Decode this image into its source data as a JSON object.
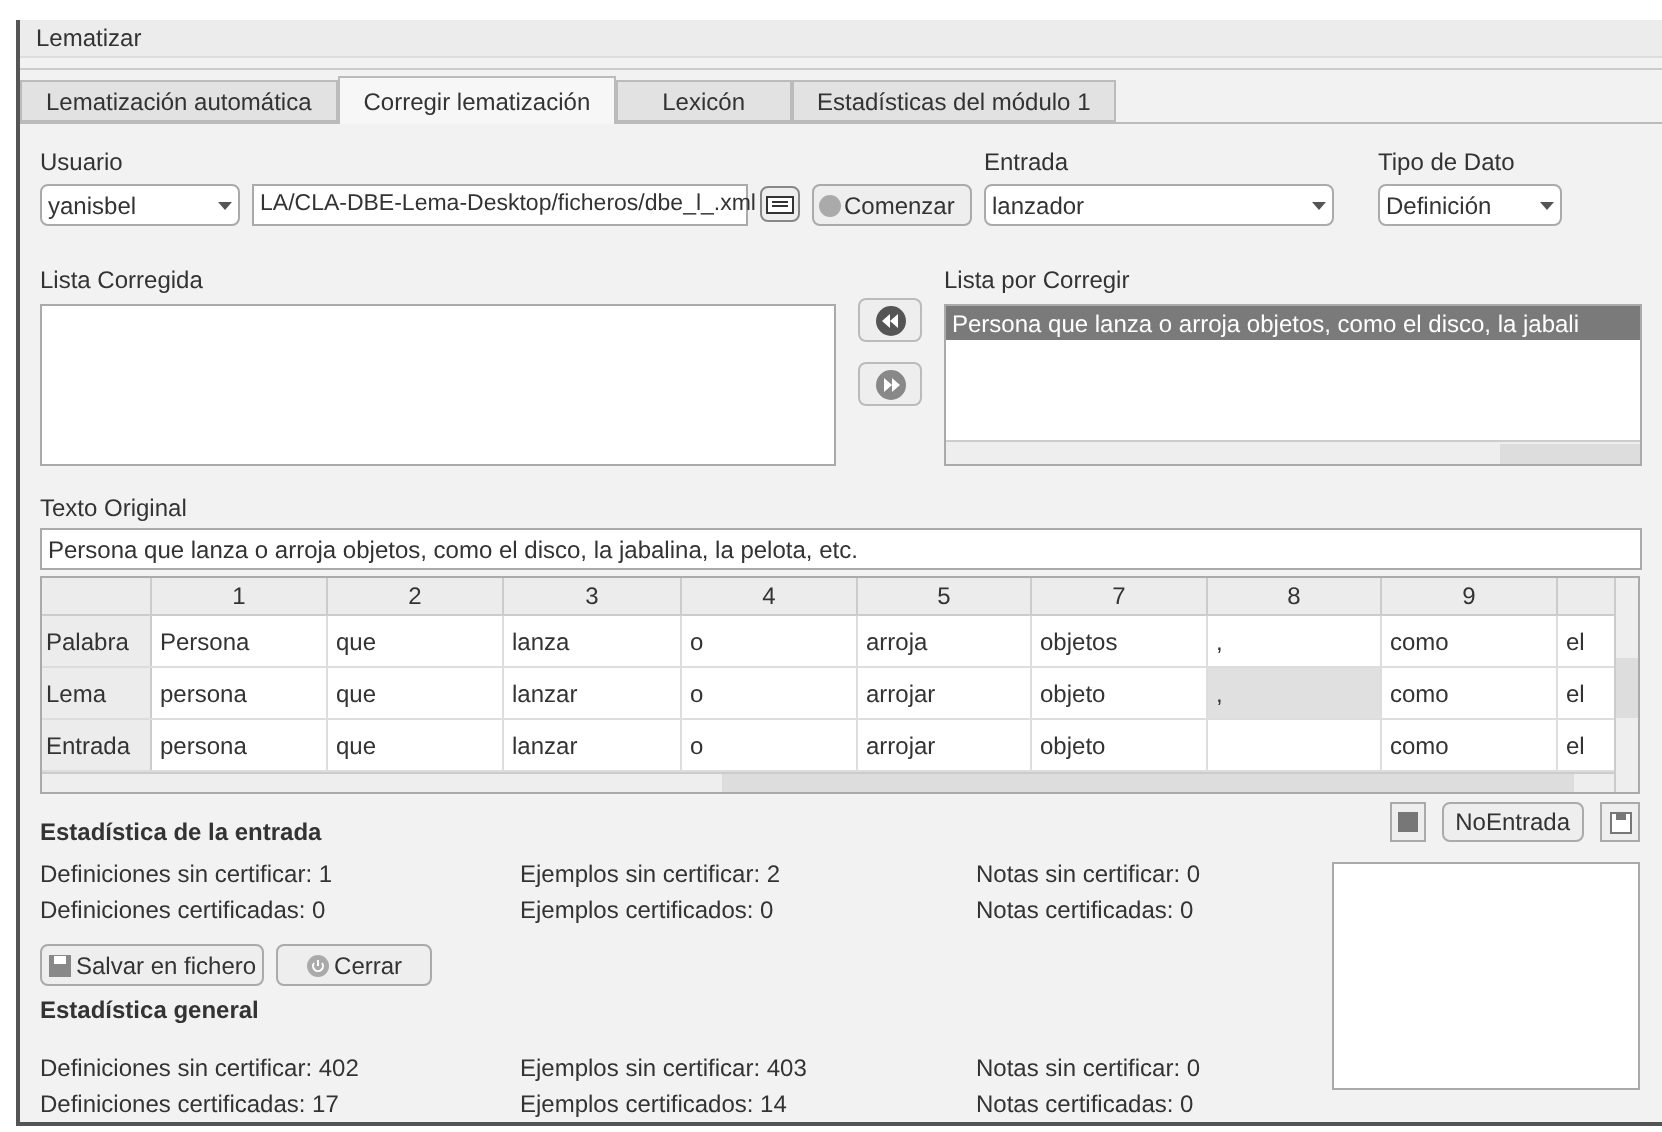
{
  "menu": [
    "Lematizar"
  ],
  "tabs": [
    {
      "label": "Lematización automática",
      "selected": false
    },
    {
      "label": "Corregir lematización",
      "selected": true
    },
    {
      "label": "Lexicón",
      "selected": false
    },
    {
      "label": "Estadísticas del módulo 1",
      "selected": false
    }
  ],
  "usuario": {
    "label": "Usuario",
    "value": "yanisbel"
  },
  "file_path": {
    "value": "LA/CLA-DBE-Lema-Desktop/ficheros/dbe_l_.xml"
  },
  "start_button": "Comenzar",
  "entrada": {
    "label": "Entrada",
    "value": "lanzador"
  },
  "tipo_de_dato": {
    "label": "Tipo de Dato",
    "value": "Definición"
  },
  "lista_corregida": {
    "label": "Lista Corregida"
  },
  "lista_por_corregir": {
    "label": "Lista por Corregir",
    "items": [
      {
        "text": "Persona que lanza o arroja objetos, como el disco, la jabali",
        "selected": true
      }
    ]
  },
  "texto_original": {
    "label": "Texto Original",
    "value": "Persona que lanza o arroja objetos, como el disco, la jabalina, la pelota, etc."
  },
  "table": {
    "columns": [
      "1",
      "2",
      "3",
      "4",
      "5",
      "7",
      "8",
      "9"
    ],
    "rows": [
      {
        "header": "Palabra",
        "cells": [
          {
            "text": "Persona",
            "selected": false
          },
          {
            "text": "que",
            "selected": false
          },
          {
            "text": "lanza",
            "selected": false
          },
          {
            "text": "o",
            "selected": false
          },
          {
            "text": "arroja",
            "selected": false
          },
          {
            "text": "objetos",
            "selected": false
          },
          {
            "text": ",",
            "selected": false
          },
          {
            "text": "como",
            "selected": false
          },
          {
            "text": "el",
            "selected": false
          }
        ]
      },
      {
        "header": "Lema",
        "cells": [
          {
            "text": "persona",
            "selected": false
          },
          {
            "text": "que",
            "selected": false
          },
          {
            "text": "lanzar",
            "selected": false
          },
          {
            "text": "o",
            "selected": false
          },
          {
            "text": "arrojar",
            "selected": false
          },
          {
            "text": "objeto",
            "selected": false
          },
          {
            "text": ",",
            "selected": true
          },
          {
            "text": "como",
            "selected": false
          },
          {
            "text": "el",
            "selected": false
          }
        ]
      },
      {
        "header": "Entrada",
        "cells": [
          {
            "text": "persona",
            "selected": false
          },
          {
            "text": "que",
            "selected": false
          },
          {
            "text": "lanzar",
            "selected": false
          },
          {
            "text": "o",
            "selected": false
          },
          {
            "text": "arrojar",
            "selected": false
          },
          {
            "text": "objeto",
            "selected": false
          },
          {
            "selected": false
          },
          {
            "text": "como",
            "selected": false
          },
          {
            "text": "el",
            "selected": false
          }
        ]
      }
    ]
  },
  "stats_entrada": {
    "title": "Estadística de la entrada",
    "lines": [
      [
        "Definiciones sin certificar: 1",
        "Ejemplos sin certificar: 2",
        "Notas sin certificar: 0"
      ],
      [
        "Definiciones certificadas: 0",
        "Ejemplos certificados: 0",
        "Notas certificadas: 0"
      ]
    ]
  },
  "buttons": [
    "Salvar en fichero",
    "Cerrar"
  ],
  "no_entrada_button": "NoEntrada",
  "stats_general": {
    "title": "Estadística general",
    "lines": [
      [
        "Definiciones sin certificar: 402",
        "Ejemplos sin certificar: 403",
        "Notas sin certificar: 0"
      ],
      [
        "Definiciones certificadas: 17",
        "Ejemplos certificados: 14",
        "Notas certificadas: 0"
      ]
    ]
  }
}
